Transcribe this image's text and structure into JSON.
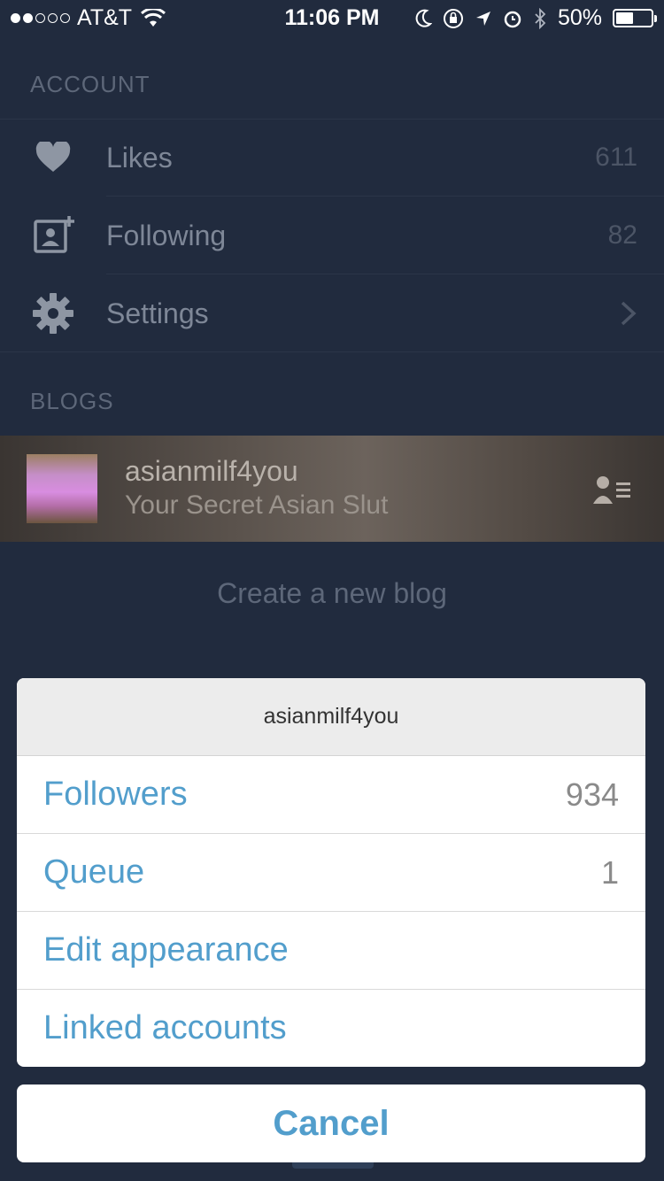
{
  "status_bar": {
    "carrier": "AT&T",
    "time": "11:06 PM",
    "battery": "50%",
    "battery_level": 0.5
  },
  "account": {
    "section_title": "ACCOUNT",
    "items": [
      {
        "label": "Likes",
        "count": "611",
        "icon": "heart-icon"
      },
      {
        "label": "Following",
        "count": "82",
        "icon": "add-contact-icon"
      },
      {
        "label": "Settings",
        "icon": "gear-icon"
      }
    ]
  },
  "blogs": {
    "section_title": "BLOGS",
    "blog": {
      "name": "asianmilf4you",
      "subtitle": "Your Secret Asian Slut"
    },
    "create_label": "Create a new blog"
  },
  "action_sheet": {
    "title": "asianmilf4you",
    "items": [
      {
        "label": "Followers",
        "value": "934"
      },
      {
        "label": "Queue",
        "value": "1"
      },
      {
        "label": "Edit appearance",
        "value": ""
      },
      {
        "label": "Linked accounts",
        "value": ""
      }
    ],
    "cancel_label": "Cancel"
  },
  "colors": {
    "background": "#212b3e",
    "accent": "#529ecc",
    "sheet_header": "#ececec"
  }
}
